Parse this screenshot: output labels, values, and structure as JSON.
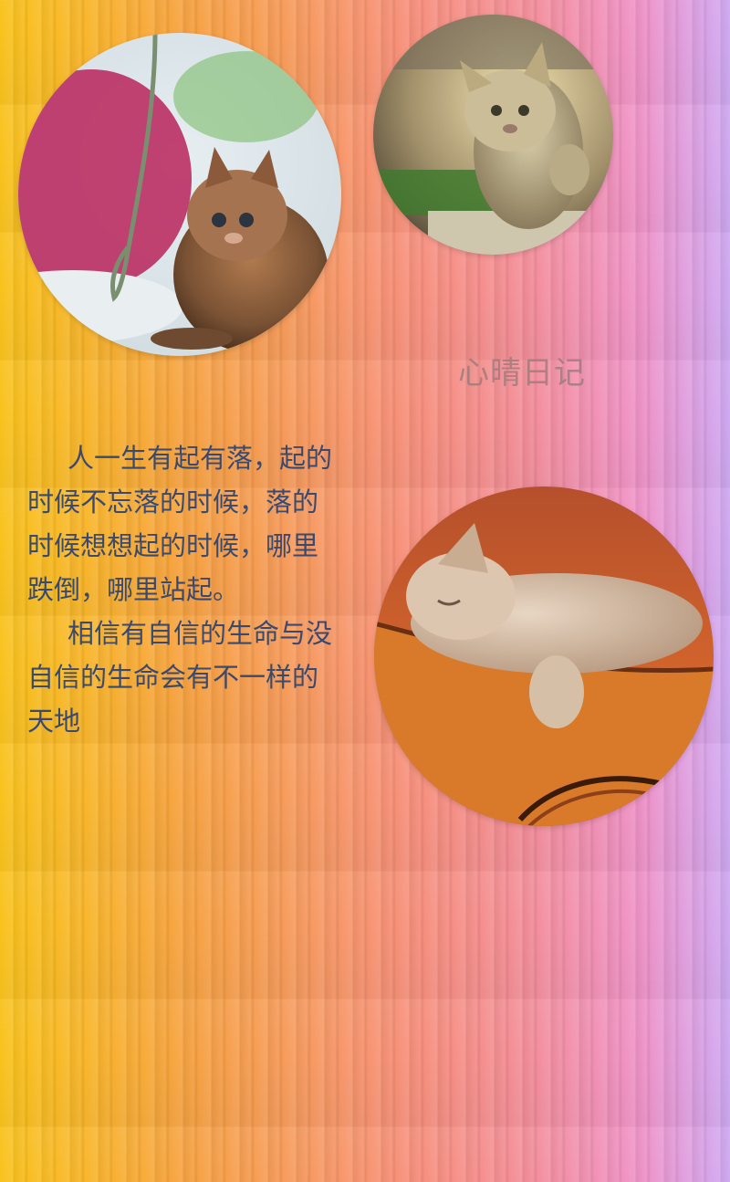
{
  "page": {
    "title": "心晴日记",
    "paragraphs": [
      "人一生有起有落，起的时候不忘落的时候，落的时候想想起的时候，哪里跌倒，哪里站起。",
      "相信有自信的生命与没自信的生命会有不一样的天地"
    ]
  },
  "photos": [
    {
      "name": "kitten-playing-with-string",
      "icon": "kitten-photo"
    },
    {
      "name": "kitten-raising-paw",
      "icon": "kitten-photo"
    },
    {
      "name": "kitten-sleeping-on-guitar",
      "icon": "kitten-photo"
    }
  ],
  "colors": {
    "background_start": "#f9c21a",
    "background_end": "#cfa8f3",
    "text": "#3a4a6e",
    "title": "#967878"
  }
}
